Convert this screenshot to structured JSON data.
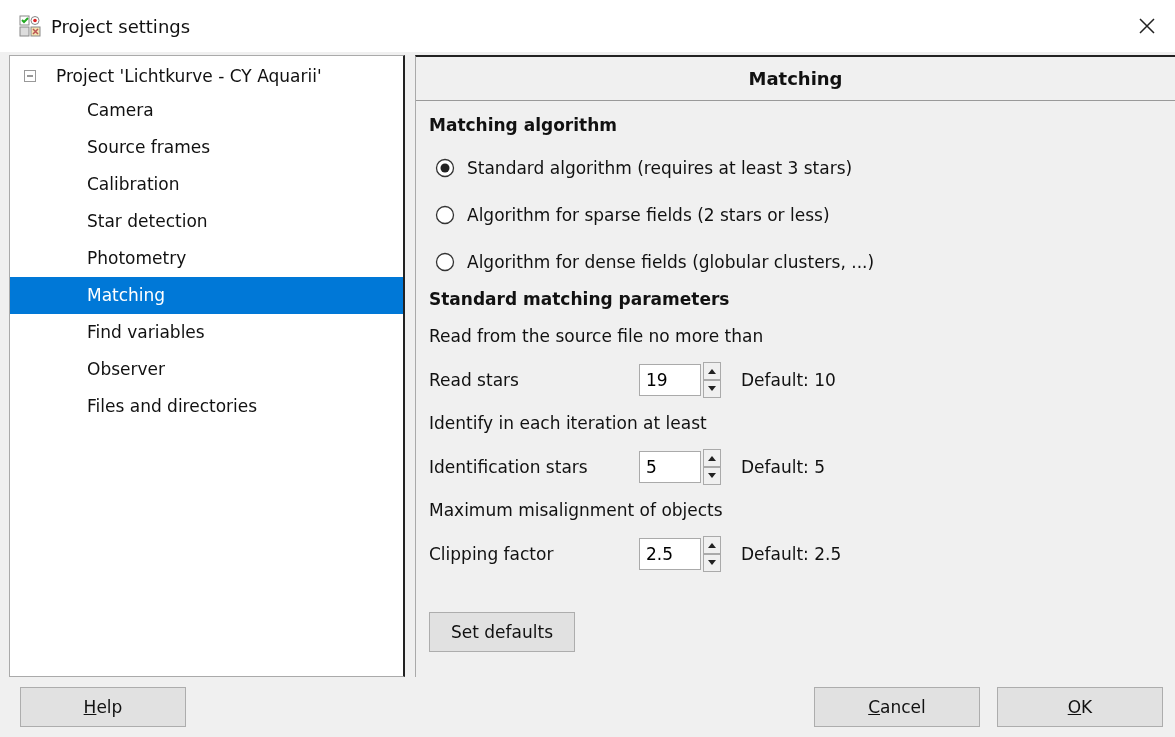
{
  "window": {
    "title": "Project settings"
  },
  "tree": {
    "label": "Project 'Lichtkurve - CY Aquarii'",
    "expanded": true,
    "children": [
      {
        "label": "Camera",
        "selected": false
      },
      {
        "label": "Source frames",
        "selected": false
      },
      {
        "label": "Calibration",
        "selected": false
      },
      {
        "label": "Star detection",
        "selected": false
      },
      {
        "label": "Photometry",
        "selected": false
      },
      {
        "label": "Matching",
        "selected": true
      },
      {
        "label": "Find variables",
        "selected": false
      },
      {
        "label": "Observer",
        "selected": false
      },
      {
        "label": "Files and directories",
        "selected": false
      }
    ]
  },
  "page": {
    "title": "Matching",
    "items": [
      {
        "kind": "heading",
        "text": "Matching algorithm"
      },
      {
        "kind": "radio",
        "label": "Standard algorithm (requires at least 3 stars)",
        "selected": true
      },
      {
        "kind": "radio",
        "label": "Algorithm for sparse fields (2 stars or less)",
        "selected": false
      },
      {
        "kind": "radio",
        "label": "Algorithm for dense fields (globular clusters, ...)",
        "selected": false
      },
      {
        "kind": "heading",
        "text": "Standard matching parameters"
      },
      {
        "kind": "text",
        "text": "Read from the source file no more than"
      },
      {
        "kind": "spin",
        "label": "Read stars",
        "value": "19",
        "default": "Default: 10"
      },
      {
        "kind": "text",
        "text": "Identify in each iteration at least"
      },
      {
        "kind": "spin",
        "label": "Identification stars",
        "value": "5",
        "default": "Default: 5"
      },
      {
        "kind": "text",
        "text": "Maximum misalignment of objects"
      },
      {
        "kind": "spin",
        "label": "Clipping factor",
        "value": "2.5",
        "default": "Default: 2.5"
      }
    ],
    "defaults_button": "Set defaults"
  },
  "left_buttons": [
    {
      "mnemonic": "H",
      "rest": "elp"
    }
  ],
  "right_buttons": [
    {
      "mnemonic": "C",
      "rest": "ancel"
    },
    {
      "mnemonic": "O",
      "rest": "K"
    }
  ]
}
